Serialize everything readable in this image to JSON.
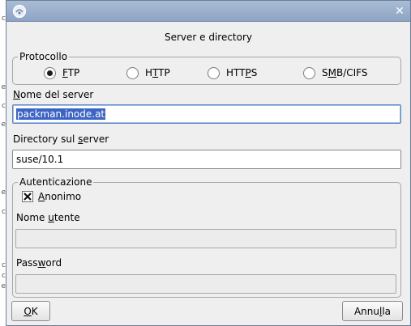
{
  "window": {
    "title": "",
    "heading": "Server e directory"
  },
  "left_strip": [
    "c",
    "e",
    "c",
    "e",
    "e",
    "c",
    "c",
    "c",
    "e"
  ],
  "protocol": {
    "legend": "Protocollo",
    "options": [
      {
        "pre": "",
        "u": "F",
        "post": "TP",
        "selected": true
      },
      {
        "pre": "H",
        "u": "T",
        "post": "TP",
        "selected": false
      },
      {
        "pre": "HTT",
        "u": "P",
        "post": "S",
        "selected": false
      },
      {
        "pre": "S",
        "u": "M",
        "post": "B/CIFS",
        "selected": false
      }
    ]
  },
  "server": {
    "label_u": "N",
    "label_rest": "ome del server",
    "value": "packman.inode.at"
  },
  "directory": {
    "label_pre": "Directory sul ",
    "label_u": "s",
    "label_post": "erver",
    "value": "suse/10.1"
  },
  "auth": {
    "legend": "Autenticazione",
    "anonymous_u": "A",
    "anonymous_rest": "nonimo",
    "anonymous_checked": true,
    "user_label_pre": "Nome ",
    "user_label_u": "u",
    "user_label_post": "tente",
    "user_value": "",
    "password_label_pre": "Pass",
    "password_label_u": "w",
    "password_label_post": "ord",
    "password_value": ""
  },
  "buttons": {
    "ok_u": "O",
    "ok_rest": "K",
    "cancel_pre": "Annu",
    "cancel_u": "l",
    "cancel_post": "la"
  }
}
